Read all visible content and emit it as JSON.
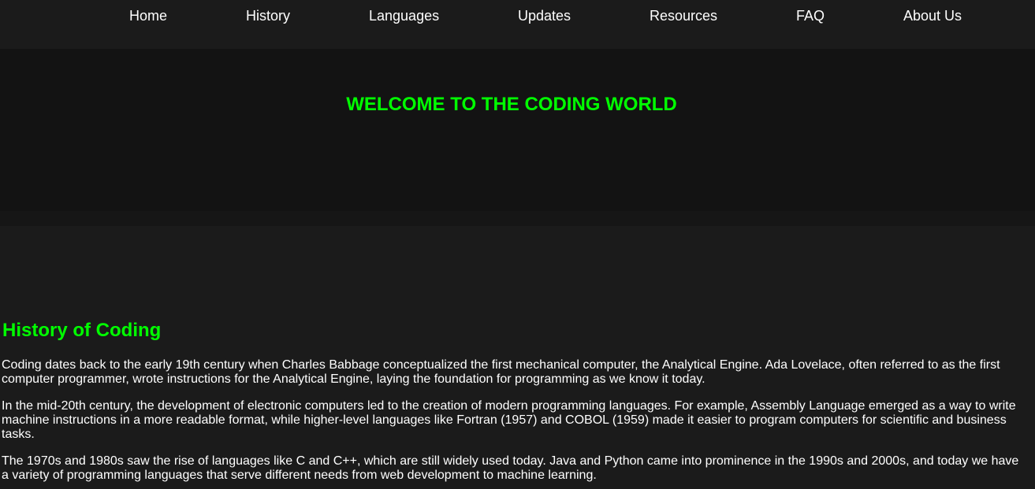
{
  "nav": {
    "items": [
      {
        "label": "Home"
      },
      {
        "label": "History"
      },
      {
        "label": "Languages"
      },
      {
        "label": "Updates"
      },
      {
        "label": "Resources"
      },
      {
        "label": "FAQ"
      },
      {
        "label": "About Us"
      }
    ]
  },
  "hero": {
    "title": "WELCOME TO THE CODING WORLD"
  },
  "history": {
    "title": "History of Coding",
    "paragraphs": [
      "Coding dates back to the early 19th century when Charles Babbage conceptualized the first mechanical computer, the Analytical Engine. Ada Lovelace, often referred to as the first computer programmer, wrote instructions for the Analytical Engine, laying the foundation for programming as we know it today.",
      "In the mid-20th century, the development of electronic computers led to the creation of modern programming languages. For example, Assembly Language emerged as a way to write machine instructions in a more readable format, while higher-level languages like Fortran (1957) and COBOL (1959) made it easier to program computers for scientific and business tasks.",
      "The 1970s and 1980s saw the rise of languages like C and C++, which are still widely used today. Java and Python came into prominence in the 1990s and 2000s, and today we have a variety of programming languages that serve different needs from web development to machine learning."
    ]
  },
  "colors": {
    "background": "#1b1b1b",
    "hero_background": "#131313",
    "accent": "#00ff00",
    "text": "#ffffff"
  }
}
